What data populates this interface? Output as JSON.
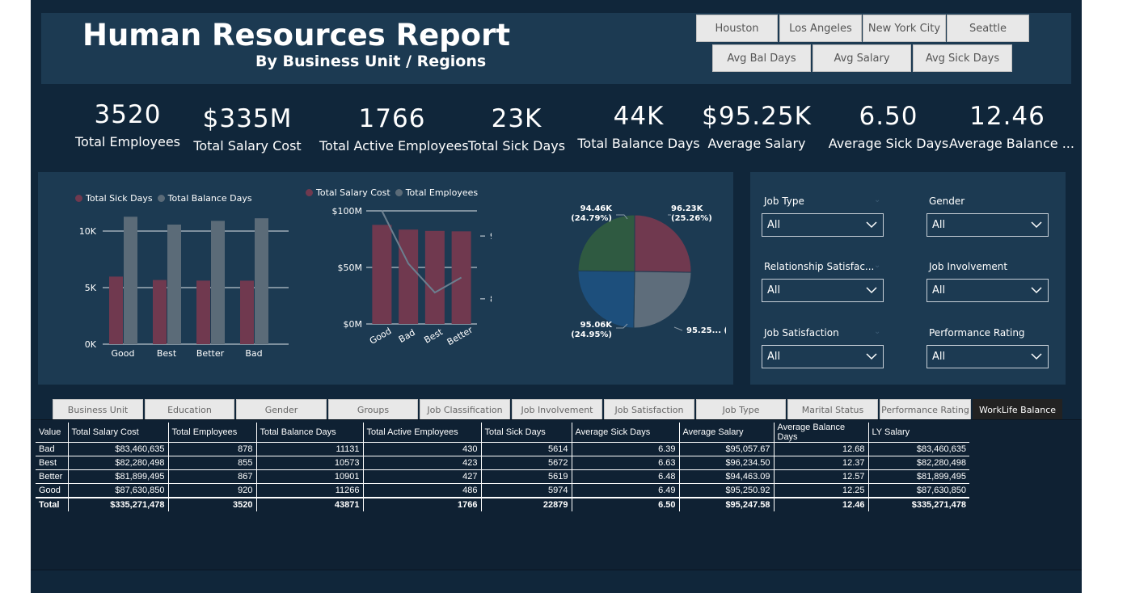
{
  "header": {
    "title": "Human Resources Report",
    "subtitle": "By Business Unit / Regions"
  },
  "city_buttons": [
    "Houston",
    "Los Angeles",
    "New York City",
    "Seattle"
  ],
  "measure_buttons": [
    "Avg Bal Days",
    "Avg Salary",
    "Avg Sick Days"
  ],
  "kpis": [
    {
      "value": "3520",
      "label": "Total Employees"
    },
    {
      "value": "$335M",
      "label": "Total Salary Cost"
    },
    {
      "value": "1766",
      "label": "Total Active Employees"
    },
    {
      "value": "23K",
      "label": "Total Sick Days"
    },
    {
      "value": "44K",
      "label": "Total Balance Days"
    },
    {
      "value": "$95.25K",
      "label": "Average Salary"
    },
    {
      "value": "6.50",
      "label": "Average Sick Days"
    },
    {
      "value": "12.46",
      "label": "Average Balance ..."
    }
  ],
  "colors": {
    "maroon": "#70394f",
    "slate": "#5b6b78",
    "green": "#2f5a41",
    "blue": "#1d4f7c",
    "grey": "#5e6d7b"
  },
  "chart_data": [
    {
      "type": "bar",
      "categories": [
        "Good",
        "Best",
        "Better",
        "Bad"
      ],
      "series": [
        {
          "name": "Total Sick Days",
          "values": [
            5974,
            5672,
            5619,
            5614
          ]
        },
        {
          "name": "Total Balance Days",
          "values": [
            11266,
            10573,
            10901,
            11131
          ]
        }
      ],
      "yticks": [
        "0K",
        "5K",
        "10K"
      ],
      "ylim": [
        0,
        12000
      ],
      "legend": "top-left"
    },
    {
      "type": "bar",
      "categories": [
        "Good",
        "Bad",
        "Best",
        "Better"
      ],
      "series": [
        {
          "name": "Total Salary Cost",
          "values": [
            87630850,
            83460635,
            82280498,
            81899495
          ]
        },
        {
          "name": "Total Employees",
          "values": [
            920,
            878,
            855,
            867
          ]
        }
      ],
      "yticks_left": [
        "$0M",
        "$50M",
        "$100M"
      ],
      "yticks_right": [
        "850",
        "900"
      ],
      "ylim_left": [
        0,
        100000000
      ],
      "ylim_right": [
        830,
        920
      ],
      "legend": "top-left"
    },
    {
      "type": "pie",
      "slices": [
        {
          "label": "96.23K (25.26%)",
          "value": 96.23
        },
        {
          "label": "95.25... (25%)",
          "value": 95.25
        },
        {
          "label": "95.06K (24.95%)",
          "value": 95.06
        },
        {
          "label": "94.46K (24.79%)",
          "value": 94.46
        }
      ]
    }
  ],
  "pie_labels": [
    {
      "line1": "96.23K",
      "line2": "(25.26%)"
    },
    {
      "line1": "95.25... (25%)",
      "line2": ""
    },
    {
      "line1": "95.06K",
      "line2": "(24.95%)"
    },
    {
      "line1": "94.46K",
      "line2": "(24.79%)"
    }
  ],
  "slicers": [
    {
      "label": "Job Type",
      "value": "All"
    },
    {
      "label": "Gender",
      "value": "All"
    },
    {
      "label": "Relationship Satisfac...",
      "value": "All"
    },
    {
      "label": "Job Involvement",
      "value": "All"
    },
    {
      "label": "Job Satisfaction",
      "value": "All"
    },
    {
      "label": "Performance Rating",
      "value": "All"
    }
  ],
  "tabs": [
    "Business Unit",
    "Education",
    "Gender",
    "Groups",
    "Job Classification",
    "Job Involvement",
    "Job Satisfaction",
    "Job Type",
    "Marital Status",
    "Performance Rating",
    "WorkLife Balance"
  ],
  "active_tab": "WorkLife Balance",
  "table": {
    "columns": [
      "Value",
      "Total Salary Cost",
      "Total Employees",
      "Total Balance Days",
      "Total Active Employees",
      "Total Sick Days",
      "Average Sick Days",
      "Average Salary",
      "Average Balance Days",
      "LY Salary"
    ],
    "rows": [
      [
        "Bad",
        "$83,460,635",
        "878",
        "11131",
        "430",
        "5614",
        "6.39",
        "$95,057.67",
        "12.68",
        "$83,460,635"
      ],
      [
        "Best",
        "$82,280,498",
        "855",
        "10573",
        "423",
        "5672",
        "6.63",
        "$96,234.50",
        "12.37",
        "$82,280,498"
      ],
      [
        "Better",
        "$81,899,495",
        "867",
        "10901",
        "427",
        "5619",
        "6.48",
        "$94,463.09",
        "12.57",
        "$81,899,495"
      ],
      [
        "Good",
        "$87,630,850",
        "920",
        "11266",
        "486",
        "5974",
        "6.49",
        "$95,250.92",
        "12.25",
        "$87,630,850"
      ]
    ],
    "total": [
      "Total",
      "$335,271,478",
      "3520",
      "43871",
      "1766",
      "22879",
      "6.50",
      "$95,247.58",
      "12.46",
      "$335,271,478"
    ]
  }
}
